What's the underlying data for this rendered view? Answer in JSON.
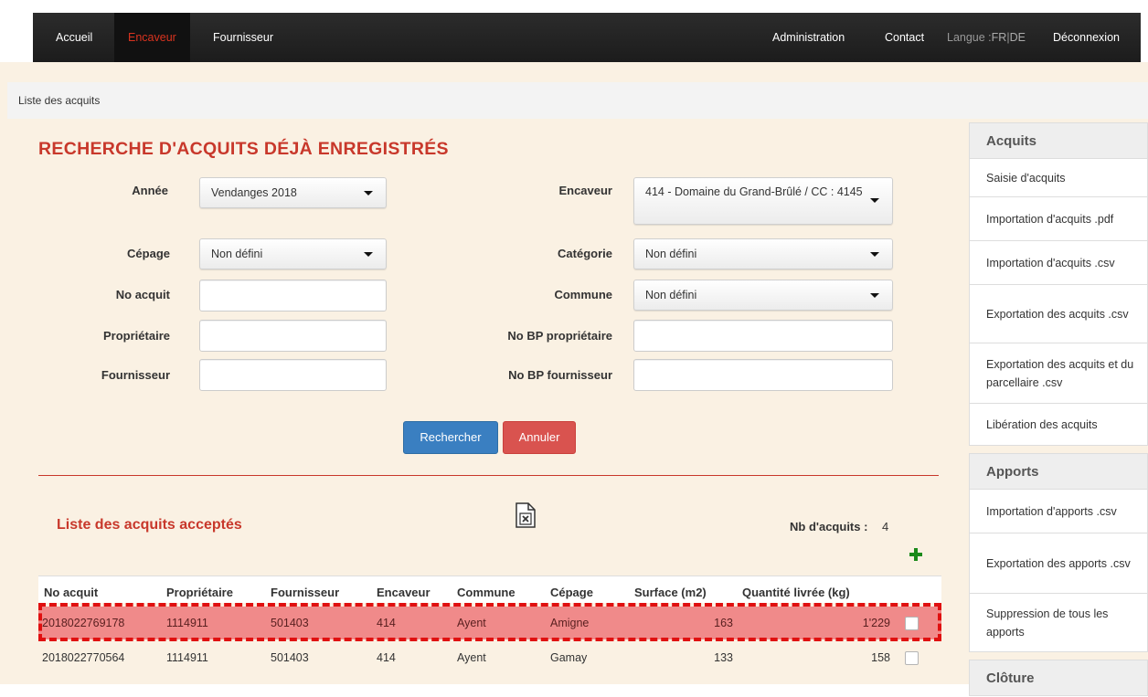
{
  "nav": {
    "left_items": [
      "Accueil",
      "Encaveur",
      "Fournisseur"
    ],
    "active_item": "Encaveur",
    "right_items": [
      "Administration",
      "Contact"
    ],
    "lang_label": "Langue :",
    "lang_fr": "FR",
    "lang_sep": "|",
    "lang_de": "DE",
    "logout": "Déconnexion"
  },
  "breadcrumb": "Liste des acquits",
  "page_title": "RECHERCHE D'ACQUITS DÉJÀ ENREGISTRÉS",
  "form": {
    "annee_label": "Année",
    "annee_value": "Vendanges 2018",
    "encaveur_label": "Encaveur",
    "encaveur_value": "414 - Domaine du Grand-Brûlé / CC : 4145",
    "cepage_label": "Cépage",
    "cepage_value": "Non défini",
    "categorie_label": "Catégorie",
    "categorie_value": "Non défini",
    "no_acquit_label": "No acquit",
    "no_acquit_value": "",
    "commune_label": "Commune",
    "commune_value": "Non défini",
    "proprietaire_label": "Propriétaire",
    "proprietaire_value": "",
    "no_bp_proprietaire_label": "No BP propriétaire",
    "no_bp_proprietaire_value": "",
    "fournisseur_label": "Fournisseur",
    "fournisseur_value": "",
    "no_bp_fournisseur_label": "No BP fournisseur",
    "no_bp_fournisseur_value": "",
    "search_button": "Rechercher",
    "cancel_button": "Annuler"
  },
  "list": {
    "title": "Liste des acquits acceptés",
    "count_label": "Nb d'acquits :",
    "count_value": "4",
    "excel_icon": "excel-export-icon",
    "add_icon": "plus-icon",
    "columns": [
      "No acquit",
      "Propriétaire",
      "Fournisseur",
      "Encaveur",
      "Commune",
      "Cépage",
      "Surface (m2)",
      "Quantité livrée (kg)"
    ],
    "rows": [
      {
        "no_acquit": "2018022769178",
        "proprietaire": "1114911",
        "fournisseur": "501403",
        "encaveur": "414",
        "commune": "Ayent",
        "cepage": "Amigne",
        "surface": "163",
        "quantite": "1'229",
        "checked": false,
        "highlighted": true
      },
      {
        "no_acquit": "2018022770564",
        "proprietaire": "1114911",
        "fournisseur": "501403",
        "encaveur": "414",
        "commune": "Ayent",
        "cepage": "Gamay",
        "surface": "133",
        "quantite": "158",
        "checked": false,
        "highlighted": false
      }
    ]
  },
  "sidebar": {
    "acquits_heading": "Acquits",
    "acquits_items": [
      "Saisie d'acquits",
      "Importation d'acquits .pdf",
      "Importation d'acquits .csv",
      "Exportation des acquits .csv",
      "Exportation des acquits et du parcellaire .csv",
      "Libération des acquits"
    ],
    "apports_heading": "Apports",
    "apports_items": [
      "Importation d'apports .csv",
      "Exportation des apports .csv",
      "Suppression de tous les apports"
    ],
    "cloture_heading": "Clôture"
  },
  "colors": {
    "accent_red": "#c8382b",
    "primary_blue": "#3a7fc1",
    "danger_red": "#d9534f",
    "highlight_row": "#f08a8a",
    "page_background": "#faf1e3"
  }
}
